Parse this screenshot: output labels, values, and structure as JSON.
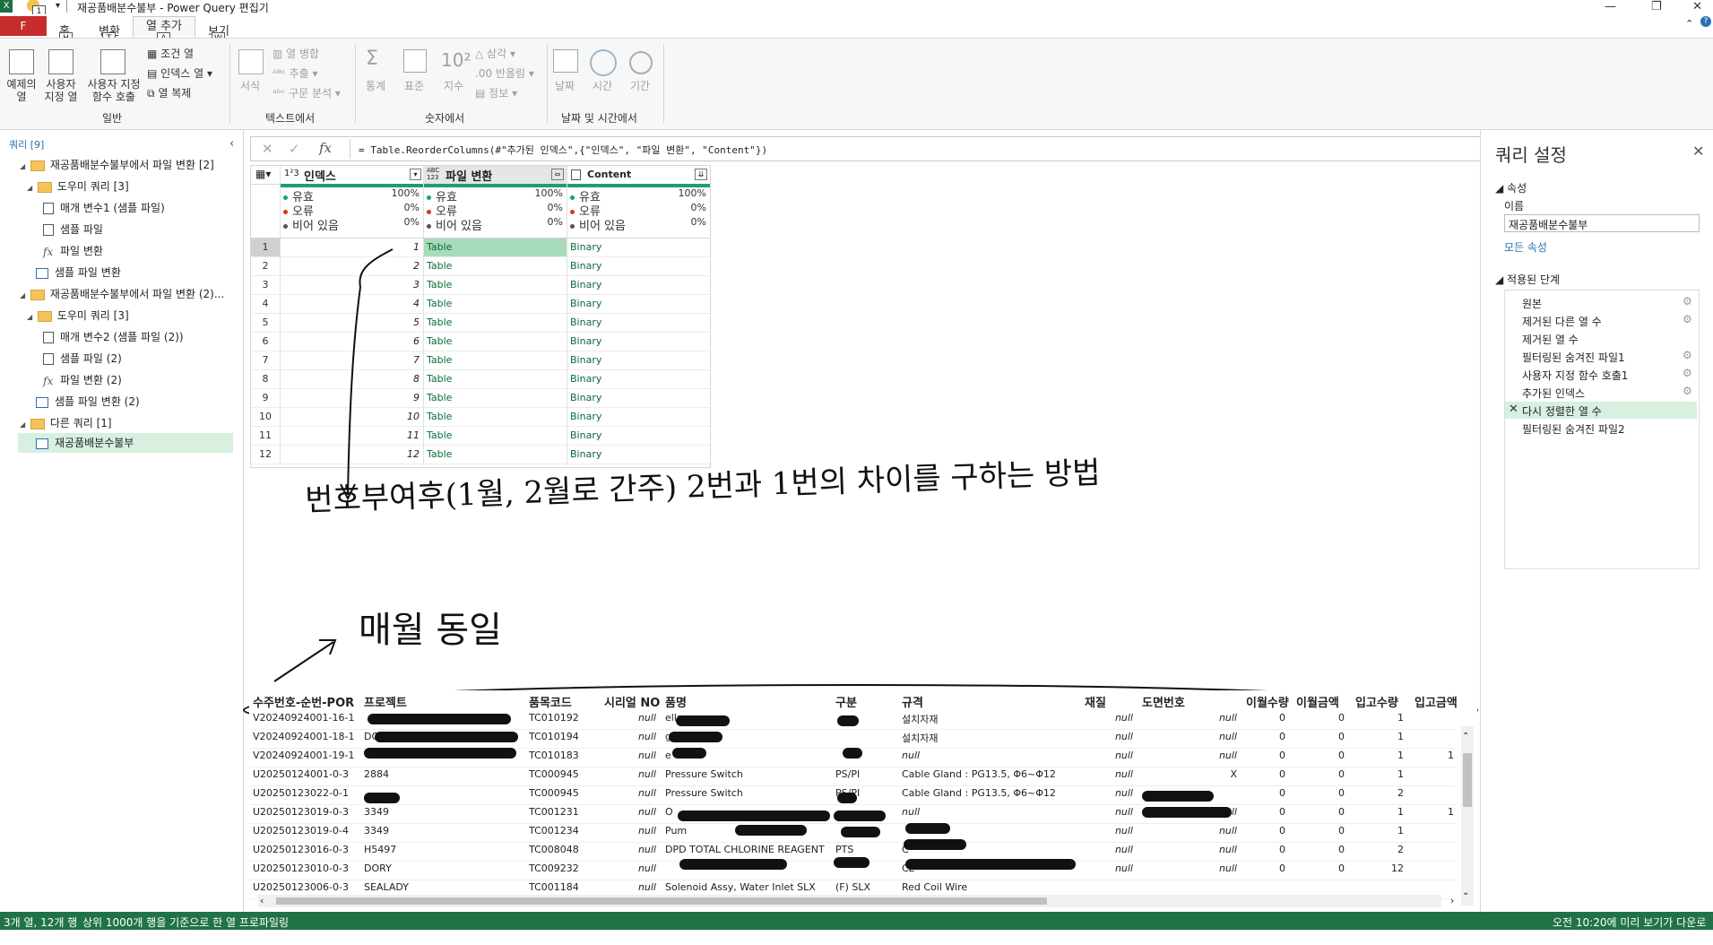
{
  "window": {
    "title": "재공품배분수불부 - Power Query 편집기",
    "qat_badge": "1",
    "excel_logo": "X"
  },
  "tabs": {
    "file": "F",
    "items": [
      "홈",
      "변환",
      "열 추가",
      "보기"
    ],
    "keytips": [
      "H",
      "T",
      "A",
      "W"
    ],
    "active_index": 2
  },
  "ribbon": {
    "general": {
      "example_col": "예제의\n열",
      "custom_col": "사용자\n지정 열",
      "custom_func": "사용자 지정\n함수 호출",
      "cond_col": "조건 열",
      "index_col": "인덱스 열",
      "dup_col": "열 복제",
      "group": "일반"
    },
    "text": {
      "format": "서식",
      "merge": "열 병합",
      "extract": "추출",
      "parse": "구문 분석",
      "group": "텍스트에서"
    },
    "number": {
      "stats": "통계",
      "standard": "표준",
      "scientific": "지수",
      "trig": "삼각",
      "rounding": "반올림",
      "info": "정보",
      "group": "숫자에서"
    },
    "datetime": {
      "date": "날짜",
      "time": "시간",
      "duration": "기간",
      "group": "날짜 및 시간에서"
    }
  },
  "queries_pane": {
    "header": "쿼리 [9]",
    "items": [
      {
        "label": "재공품배분수불부에서 파일 변환 [2]",
        "kind": "folder"
      },
      {
        "label": "도우미 쿼리 [3]",
        "kind": "folder"
      },
      {
        "label": "매개 변수1 (샘플 파일)",
        "kind": "param"
      },
      {
        "label": "샘플 파일",
        "kind": "param"
      },
      {
        "label": "파일 변환",
        "kind": "fx"
      },
      {
        "label": "샘플 파일 변환",
        "kind": "table"
      },
      {
        "label": "재공품배분수불부에서 파일 변환 (2)...",
        "kind": "folder"
      },
      {
        "label": "도우미 쿼리 [3]",
        "kind": "folder"
      },
      {
        "label": "매개 변수2 (샘플 파일 (2))",
        "kind": "param"
      },
      {
        "label": "샘플 파일 (2)",
        "kind": "param"
      },
      {
        "label": "파일 변환 (2)",
        "kind": "fx"
      },
      {
        "label": "샘플 파일 변환 (2)",
        "kind": "table"
      },
      {
        "label": "다른 쿼리 [1]",
        "kind": "folder"
      },
      {
        "label": "재공품배분수불부",
        "kind": "table"
      }
    ]
  },
  "formula_bar": {
    "fx": "fx",
    "text": "= Table.ReorderColumns(#\"추가된 인덱스\",{\"인덱스\", \"파일 변환\", \"Content\"})"
  },
  "preview": {
    "columns": [
      {
        "type": "1²3",
        "name": "인덱스"
      },
      {
        "type": "ABC\n123",
        "name": "파일 변환"
      },
      {
        "type": "",
        "name": "Content"
      }
    ],
    "profile": {
      "valid": "유효",
      "error": "오류",
      "empty": "비어 있음",
      "valid_pct": "100%",
      "error_pct": "0%",
      "empty_pct": "0%"
    },
    "rows": [
      [
        "1",
        "1",
        "Table",
        "Binary"
      ],
      [
        "2",
        "2",
        "Table",
        "Binary"
      ],
      [
        "3",
        "3",
        "Table",
        "Binary"
      ],
      [
        "4",
        "4",
        "Table",
        "Binary"
      ],
      [
        "5",
        "5",
        "Table",
        "Binary"
      ],
      [
        "6",
        "6",
        "Table",
        "Binary"
      ],
      [
        "7",
        "7",
        "Table",
        "Binary"
      ],
      [
        "8",
        "8",
        "Table",
        "Binary"
      ],
      [
        "9",
        "9",
        "Table",
        "Binary"
      ],
      [
        "10",
        "10",
        "Table",
        "Binary"
      ],
      [
        "11",
        "11",
        "Table",
        "Binary"
      ],
      [
        "12",
        "12",
        "Table",
        "Binary"
      ]
    ]
  },
  "annotations": {
    "note1": "번호부여후(1월, 2월로 간주) 2번과 1번의 차이를 구하는 방법",
    "note2": "매월 동일"
  },
  "sheet": {
    "headers": [
      "수주번호-순번-POR",
      "프로젝트",
      "품목코드",
      "시리얼 NO",
      "품명",
      "구분",
      "규격",
      "재질",
      "도면번호",
      "이월수량",
      "이월금액",
      "입고수량",
      "입고금액"
    ],
    "rows": [
      [
        "V20240924001-16-1",
        "",
        "TC010192",
        "null",
        "ellaneous",
        "",
        "설치자재",
        "null",
        "null",
        "0",
        "0",
        "1",
        ""
      ],
      [
        "V20240924001-18-1",
        "DO",
        "TC010194",
        "null",
        "ge",
        "",
        "설치자재",
        "null",
        "null",
        "0",
        "0",
        "1",
        ""
      ],
      [
        "V20240924001-19-1",
        "",
        "TC010183",
        "null",
        "e",
        "",
        "null",
        "null",
        "null",
        "0",
        "0",
        "1",
        "1"
      ],
      [
        "U20250124001-0-3",
        "2884",
        "TC000945",
        "null",
        "Pressure Switch",
        "PS/PI",
        "Cable Gland : PG13.5, Φ6~Φ12",
        "null",
        "X",
        "0",
        "0",
        "1",
        ""
      ],
      [
        "U20250123022-0-1",
        "",
        "TC000945",
        "null",
        "Pressure Switch",
        "PS/PI",
        "Cable Gland : PG13.5, Φ6~Φ12",
        "null",
        "",
        "0",
        "0",
        "2",
        ""
      ],
      [
        "U20250123019-0-3",
        "3349",
        "TC001231",
        "null",
        "O",
        "",
        "null",
        "null",
        "null",
        "0",
        "0",
        "1",
        "1"
      ],
      [
        "U20250123019-0-4",
        "3349",
        "TC001234",
        "null",
        "Pum",
        "",
        "",
        "null",
        "null",
        "0",
        "0",
        "1",
        ""
      ],
      [
        "U20250123016-0-3",
        "H5497",
        "TC008048",
        "null",
        "DPD TOTAL CHLORINE REAGENT",
        "PTS",
        "C",
        "null",
        "null",
        "0",
        "0",
        "2",
        ""
      ],
      [
        "U20250123010-0-3",
        "DORY",
        "TC009232",
        "null",
        "",
        "",
        "CL",
        "null",
        "null",
        "0",
        "0",
        "12",
        ""
      ]
    ],
    "partial_row": [
      "U20250123006-0-3",
      "SEALADY",
      "TC001184",
      "null",
      "Solenoid Assy, Water Inlet SLX",
      "(F) SLX",
      "Red Coil Wire"
    ]
  },
  "settings_pane": {
    "title": "쿼리 설정",
    "props_header": "속성",
    "name_label": "이름",
    "name_value": "재공품배분수불부",
    "all_props": "모든 속성",
    "steps_header": "적용된 단계",
    "steps": [
      "원본",
      "제거된 다른 열 수",
      "제거된 열 수",
      "필터링된 숨겨진 파일1",
      "사용자 지정 함수 호출1",
      "추가된 인덱스",
      "다시 정렬한 열 수",
      "필터링된 숨겨진 파일2"
    ],
    "active_step": 6
  },
  "status": {
    "left1": "3개 열, 12개 행",
    "left2": "상위 1000개 행을 기준으로 한 열 프로파일링",
    "right": "오전 10:20에 미리 보기가 다운로드됨"
  },
  "colors": {
    "status_bar": "#217346",
    "file_tab": "#c62c2c",
    "selected_bg": "#d7f0e0",
    "table_link": "#0b6b3a"
  }
}
